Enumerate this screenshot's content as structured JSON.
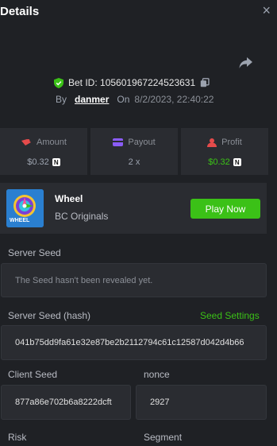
{
  "header": {
    "title": "Details",
    "close_glyph": "×"
  },
  "bet": {
    "id_label": "Bet ID: 105601967224523631",
    "by_label": "By",
    "user": "danmer",
    "on_label": "On",
    "date": "8/2/2023, 22:40:22"
  },
  "stats": [
    {
      "label": "Amount",
      "value": "$0.32",
      "coin": "N"
    },
    {
      "label": "Payout",
      "value": "2 x"
    },
    {
      "label": "Profit",
      "value": "$0.32",
      "coin": "N"
    }
  ],
  "game": {
    "name": "Wheel",
    "provider": "BC Originals",
    "thumb_text": "WHEEL",
    "play_label": "Play Now"
  },
  "seeds": {
    "server_seed_label": "Server Seed",
    "server_seed_value": "The Seed hasn't been revealed yet.",
    "server_seed_hash_label": "Server Seed (hash)",
    "seed_settings_label": "Seed Settings",
    "server_seed_hash_value": "041b75dd9fa61e32e87be2b2112794c61c12587d042d4b66",
    "client_seed_label": "Client Seed",
    "client_seed_value": "877a86e702b6a8222dcft",
    "nonce_label": "nonce",
    "nonce_value": "2927",
    "risk_label": "Risk",
    "segment_label": "Segment"
  },
  "colors": {
    "accent": "#3bc117",
    "profit_red": "#e54b4b",
    "payout_purple": "#8a5cf6",
    "background": "#1f2125",
    "card": "#2a2c31"
  }
}
